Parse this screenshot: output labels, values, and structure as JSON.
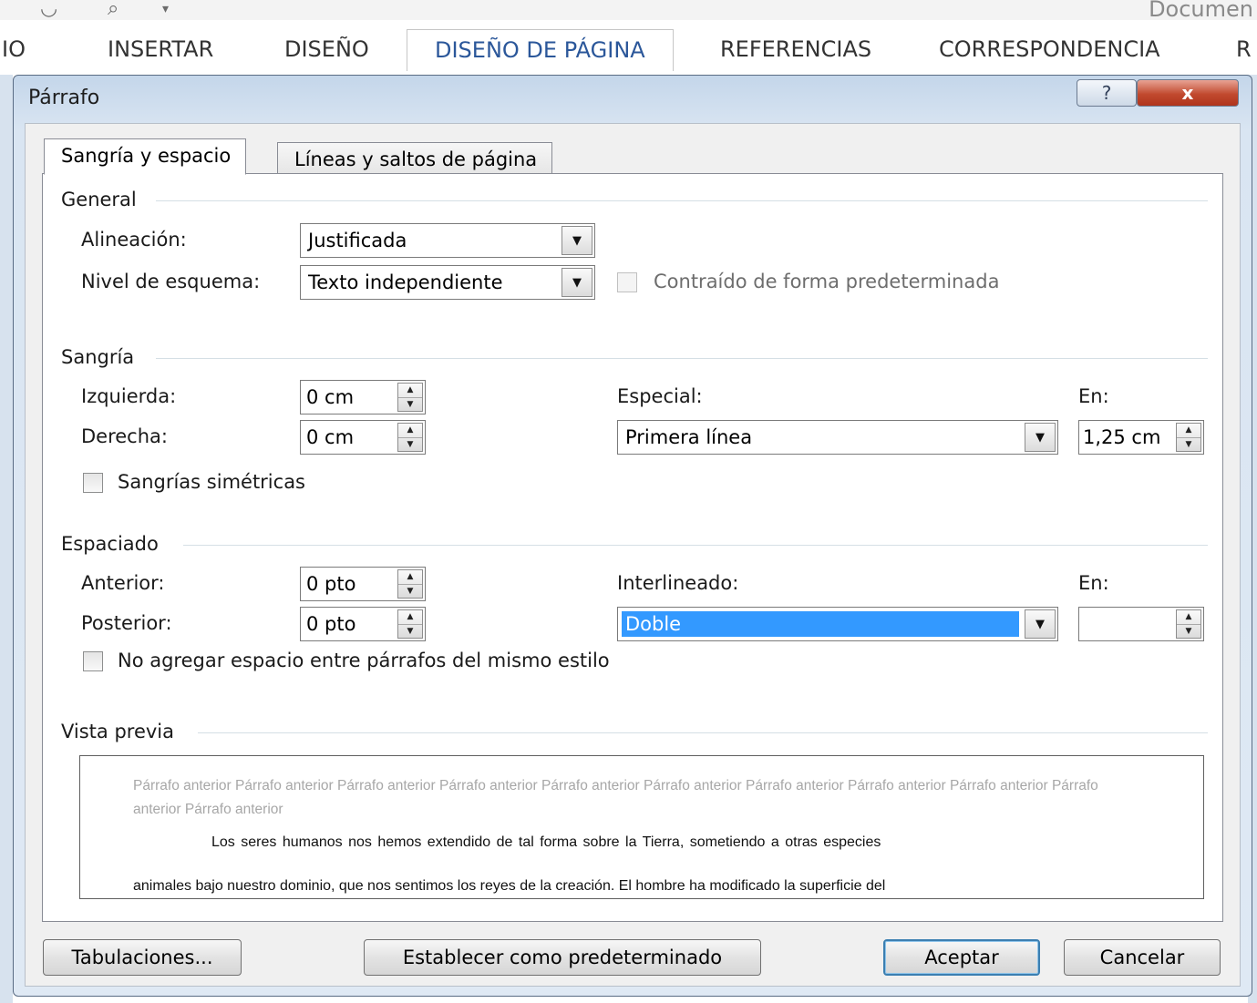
{
  "ribbon": {
    "document_title": "Documen",
    "tabs": [
      "IO",
      "INSERTAR",
      "DISEÑO",
      "DISEÑO DE PÁGINA",
      "REFERENCIAS",
      "CORRESPONDENCIA",
      "R"
    ],
    "active_tab": "DISEÑO DE PÁGINA"
  },
  "dialog": {
    "title": "Párrafo",
    "help_label": "?",
    "close_label": "x",
    "tabs": [
      "Sangría y espacio",
      "Líneas y saltos de página"
    ],
    "active_tab": "Sangría y espacio"
  },
  "general": {
    "heading": "General",
    "alignment_label": "Alineación:",
    "alignment_value": "Justificada",
    "outline_label": "Nivel de esquema:",
    "outline_value": "Texto independiente",
    "collapsed_label": "Contraído de forma predeterminada",
    "collapsed_checked": false
  },
  "indent": {
    "heading": "Sangría",
    "left_label": "Izquierda:",
    "left_value": "0 cm",
    "right_label": "Derecha:",
    "right_value": "0 cm",
    "special_label": "Especial:",
    "special_value": "Primera línea",
    "by_label": "En:",
    "by_value": "1,25 cm",
    "mirror_label": "Sangrías simétricas",
    "mirror_checked": false
  },
  "spacing": {
    "heading": "Espaciado",
    "before_label": "Anterior:",
    "before_value": "0 pto",
    "after_label": "Posterior:",
    "after_value": "0 pto",
    "line_label": "Interlineado:",
    "line_value": "Doble",
    "at_label": "En:",
    "at_value": "",
    "no_space_label": "No agregar espacio entre párrafos del mismo estilo",
    "no_space_checked": false
  },
  "preview": {
    "heading": "Vista previa",
    "previous_text": "Párrafo anterior Párrafo anterior Párrafo anterior Párrafo anterior Párrafo anterior Párrafo anterior Párrafo anterior Párrafo anterior Párrafo anterior Párrafo anterior Párrafo anterior",
    "line1": "Los seres humanos nos hemos extendido de tal forma sobre la Tierra, sometiendo a otras especies",
    "line2": "animales bajo nuestro dominio, que nos sentimos los reyes de la creación. El hombre ha modificado la superficie del"
  },
  "buttons": {
    "tabs": "Tabulaciones...",
    "set_default": "Establecer como predeterminado",
    "ok": "Aceptar",
    "cancel": "Cancelar"
  },
  "colors": {
    "selection": "#3399ff",
    "close_button": "#c14a2f",
    "active_ribbon_tab": "#2b579a",
    "default_button_border": "#3c7fb1"
  },
  "icons": [
    "undo-icon",
    "print-preview-icon",
    "dropdown-arrow-icon",
    "spinner-icon",
    "help-icon",
    "close-icon"
  ]
}
